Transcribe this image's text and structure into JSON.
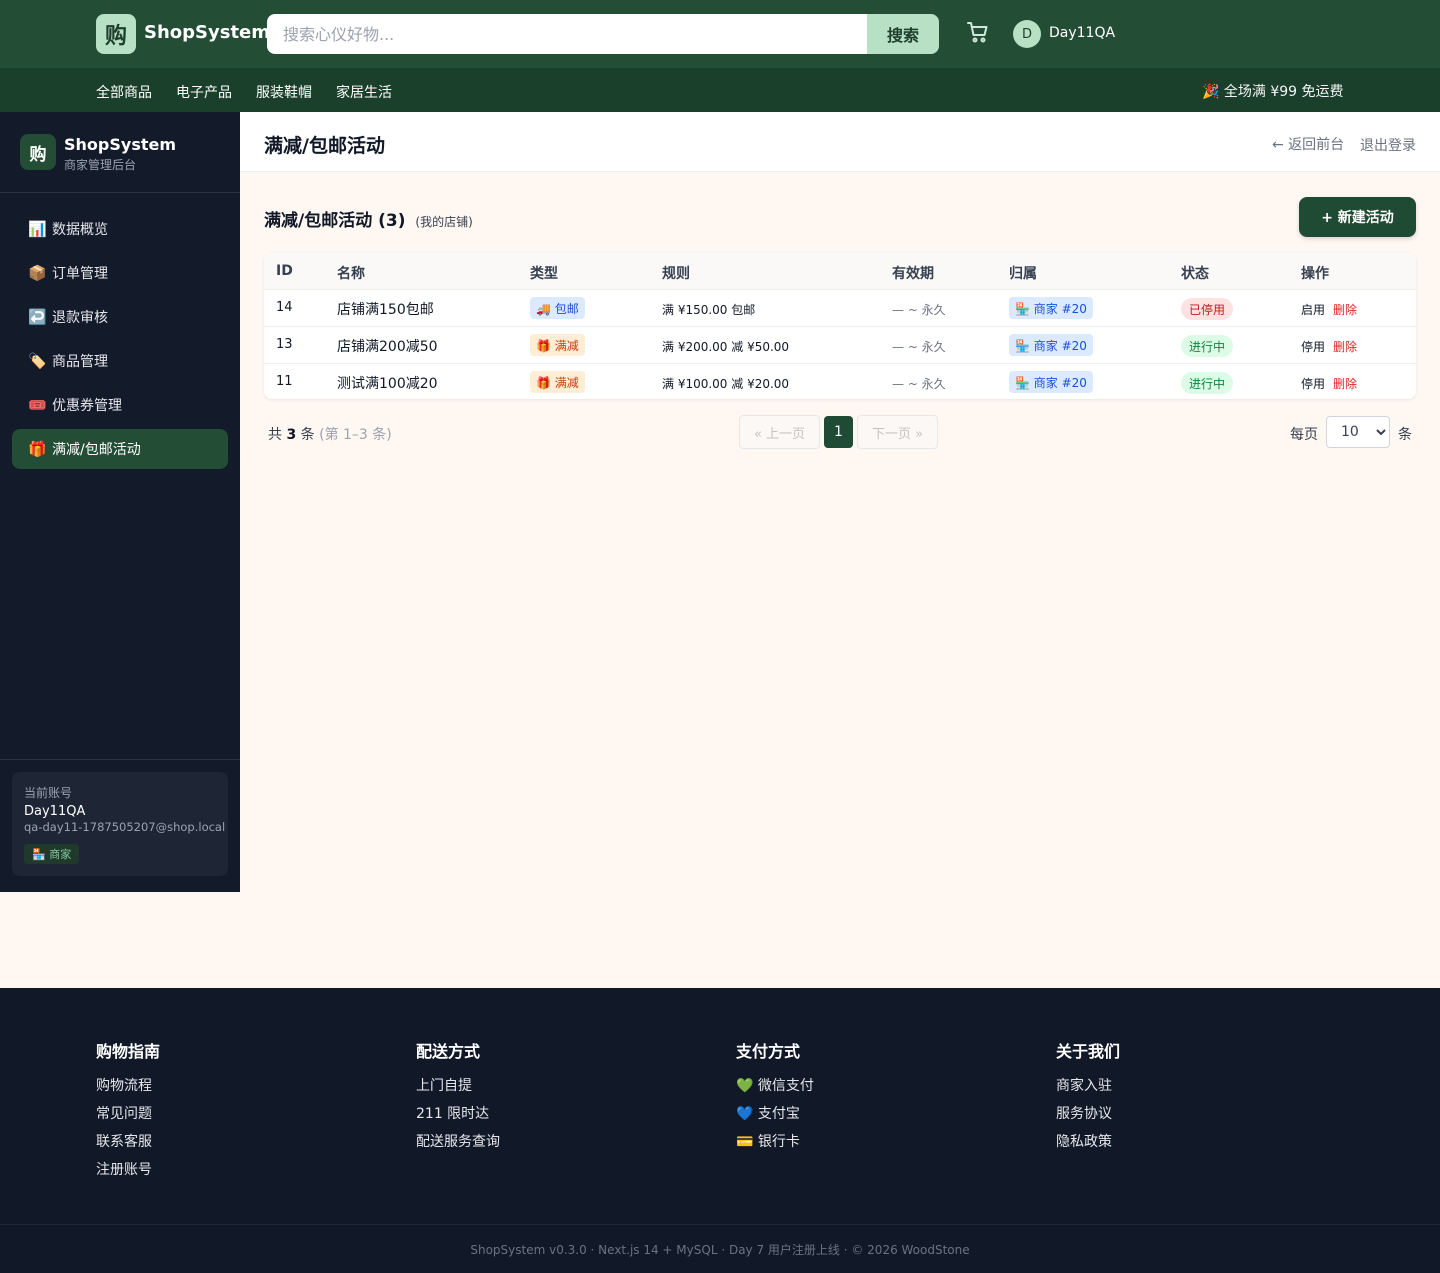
{
  "header": {
    "logo_char": "购",
    "brand": "ShopSystem",
    "search_placeholder": "搜索心仪好物...",
    "search_label": "搜索",
    "avatar_letter": "D",
    "username": "Day11QA"
  },
  "nav": {
    "items": [
      "全部商品",
      "电子产品",
      "服装鞋帽",
      "家居生活"
    ],
    "promo": "🎉 全场满 ¥99 免运费"
  },
  "sidebar": {
    "logo_char": "购",
    "brand": "ShopSystem",
    "subtitle": "商家管理后台",
    "items": [
      {
        "icon": "📊",
        "label": "数据概览"
      },
      {
        "icon": "📦",
        "label": "订单管理"
      },
      {
        "icon": "↩️",
        "label": "退款审核"
      },
      {
        "icon": "🏷️",
        "label": "商品管理"
      },
      {
        "icon": "🎟️",
        "label": "优惠券管理"
      },
      {
        "icon": "🎁",
        "label": "满减/包邮活动"
      }
    ],
    "account": {
      "caption": "当前账号",
      "name": "Day11QA",
      "email": "qa-day11-1787505207@shop.local",
      "role": "🏪 商家"
    }
  },
  "main": {
    "title": "满减/包邮活动",
    "back": "← 返回前台",
    "logout": "退出登录",
    "section_title": "满减/包邮活动 (3)",
    "section_sub": "(我的店铺)",
    "new_button": "+ 新建活动",
    "columns": [
      "ID",
      "名称",
      "类型",
      "规则",
      "有效期",
      "归属",
      "状态",
      "操作"
    ],
    "rows": [
      {
        "id": "14",
        "name": "店铺满150包邮",
        "type": "🚚 包邮",
        "type_kind": "ship",
        "rule": "满 ¥150.00 包邮",
        "valid": "— ~ 永久",
        "owner": "🏪 商家 #20",
        "status": "已停用",
        "status_kind": "off",
        "toggle": "启用",
        "delete": "删除"
      },
      {
        "id": "13",
        "name": "店铺满200减50",
        "type": "🎁 满减",
        "type_kind": "cut",
        "rule": "满 ¥200.00 减 ¥50.00",
        "valid": "— ~ 永久",
        "owner": "🏪 商家 #20",
        "status": "进行中",
        "status_kind": "on",
        "toggle": "停用",
        "delete": "删除"
      },
      {
        "id": "11",
        "name": "测试满100减20",
        "type": "🎁 满减",
        "type_kind": "cut",
        "rule": "满 ¥100.00 减 ¥20.00",
        "valid": "— ~ 永久",
        "owner": "🏪 商家 #20",
        "status": "进行中",
        "status_kind": "on",
        "toggle": "停用",
        "delete": "删除"
      }
    ],
    "pagination": {
      "total_prefix": "共",
      "total": "3",
      "total_suffix": "条",
      "range": "(第 1–3 条)",
      "prev": "« 上一页",
      "current": "1",
      "next": "下一页 »",
      "per_label": "每页",
      "per_value": "10",
      "per_unit": "条"
    }
  },
  "footer": {
    "columns": [
      {
        "title": "购物指南",
        "links": [
          "购物流程",
          "常见问题",
          "联系客服",
          "注册账号"
        ]
      },
      {
        "title": "配送方式",
        "links": [
          "上门自提",
          "211 限时达",
          "配送服务查询"
        ]
      },
      {
        "title": "支付方式",
        "links": [
          "💚 微信支付",
          "💙 支付宝",
          "💳 银行卡"
        ]
      },
      {
        "title": "关于我们",
        "links": [
          "商家入驻",
          "服务协议",
          "隐私政策"
        ]
      }
    ],
    "copyright": "ShopSystem v0.3.0 · Next.js 14 + MySQL · Day 7 用户注册上线 · © 2026 WoodStone"
  }
}
